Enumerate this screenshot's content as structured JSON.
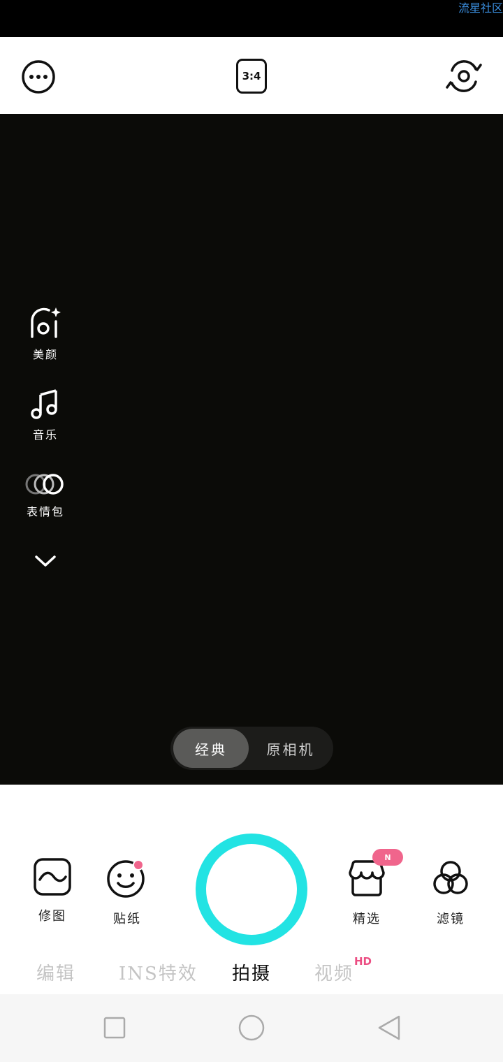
{
  "status_bar": {
    "watermark": "流星社区"
  },
  "top_bar": {
    "more_icon": "more-icon",
    "aspect_ratio": "3:4",
    "flip_icon": "flip-camera-icon"
  },
  "side_tools": [
    {
      "label": "美颜",
      "icon": "beauty-icon"
    },
    {
      "label": "音乐",
      "icon": "music-icon"
    },
    {
      "label": "表情包",
      "icon": "sticker-pack-icon"
    }
  ],
  "capture_modes": [
    {
      "label": "经典",
      "active": true
    },
    {
      "label": "原相机",
      "active": false
    }
  ],
  "bottom_tools": {
    "left": [
      {
        "label": "修图",
        "icon": "edit-photo-icon"
      },
      {
        "label": "贴纸",
        "icon": "sticker-icon"
      }
    ],
    "right": [
      {
        "label": "精选",
        "icon": "store-icon",
        "badge": "N"
      },
      {
        "label": "滤镜",
        "icon": "filter-icon"
      }
    ]
  },
  "tabs": [
    {
      "label": "编辑",
      "active": false
    },
    {
      "label": "INS特效",
      "active": false
    },
    {
      "label": "拍摄",
      "active": true
    },
    {
      "label": "视频",
      "active": false,
      "badge": "HD"
    }
  ],
  "colors": {
    "shutter_ring": "#22e3e3",
    "accent_pink": "#ec4e83"
  }
}
